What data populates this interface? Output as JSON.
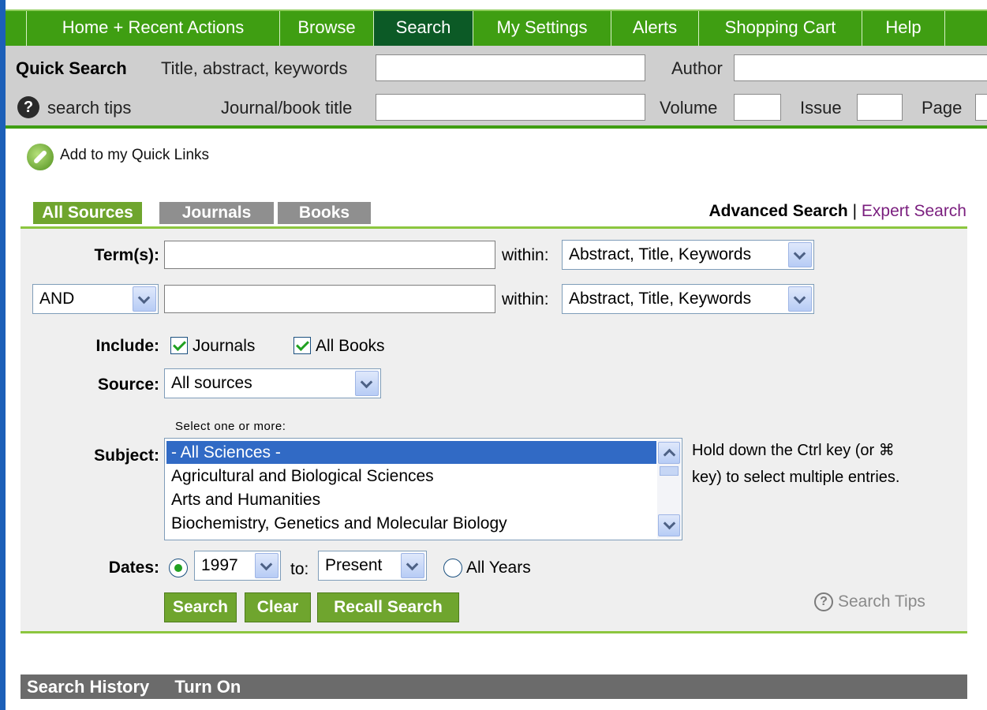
{
  "nav": {
    "tabs": [
      {
        "label": "Home + Recent Actions"
      },
      {
        "label": "Browse"
      },
      {
        "label": "Search"
      },
      {
        "label": "My Settings"
      },
      {
        "label": "Alerts"
      },
      {
        "label": "Shopping Cart"
      },
      {
        "label": "Help"
      }
    ],
    "active_tab": "Search"
  },
  "quick_search": {
    "title": "Quick Search",
    "title_abstract_label": "Title, abstract, keywords",
    "author_label": "Author",
    "search_tips_label": "search tips",
    "journal_label": "Journal/book title",
    "volume_label": "Volume",
    "issue_label": "Issue",
    "page_label": "Page",
    "help_icon": "?"
  },
  "quick_links": {
    "label": "Add to my Quick Links"
  },
  "source_tabs": [
    {
      "label": "All Sources",
      "active": true
    },
    {
      "label": "Journals",
      "active": false
    },
    {
      "label": "Books",
      "active": false
    }
  ],
  "mode": {
    "advanced": "Advanced Search",
    "separator": "|",
    "expert": "Expert Search"
  },
  "form": {
    "terms_label": "Term(s):",
    "within_label": "within:",
    "within_value_1": "Abstract, Title, Keywords",
    "within_value_2": "Abstract, Title, Keywords",
    "operator": "AND",
    "include_label": "Include:",
    "include_journals": "Journals",
    "include_books": "All Books",
    "source_label": "Source:",
    "source_value": "All sources",
    "select_hint": "Select one or more:",
    "subject_label": "Subject:",
    "subjects": [
      "- All Sciences -",
      "Agricultural and Biological Sciences",
      "Arts and Humanities",
      "Biochemistry, Genetics and Molecular Biology"
    ],
    "ctrl_hint_1": "Hold down the Ctrl key (or ⌘",
    "ctrl_hint_2": "key) to select multiple entries.",
    "dates_label": "Dates:",
    "date_from": "1997",
    "to_label": "to:",
    "date_to": "Present",
    "all_years": "All Years",
    "buttons": {
      "search": "Search",
      "clear": "Clear",
      "recall": "Recall Search"
    },
    "search_tips": "Search Tips"
  },
  "history": {
    "label": "Search History",
    "action": "Turn On"
  },
  "colors": {
    "nav_green": "#3f9e12",
    "nav_active": "#0c5a26",
    "tab_green": "#6fa52e",
    "tab_gray": "#8f8f8f",
    "expert_link": "#7a1e7e",
    "selected_row": "#316ac5"
  }
}
